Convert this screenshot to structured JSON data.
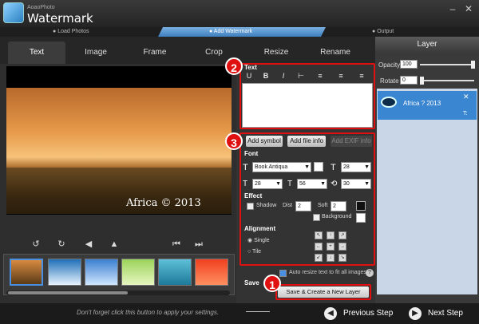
{
  "app": {
    "brand_sub": "AoaoPhoto",
    "title": "Watermark"
  },
  "steps": [
    "Load Photos",
    "Add Watermark",
    "Output"
  ],
  "tabs": [
    "Text",
    "Image",
    "Frame",
    "Crop",
    "Resize",
    "Rename"
  ],
  "preview": {
    "watermark_text": "Africa © 2013"
  },
  "text_section": {
    "label": "Text"
  },
  "buttons": {
    "add_symbol": "Add symbol",
    "add_file_info": "Add file info",
    "add_exif_info": "Add EXIF info"
  },
  "font": {
    "label": "Font",
    "family": "Book Antiqua",
    "size": "28",
    "w": "28",
    "h": "56",
    "angle": "30"
  },
  "effect": {
    "label": "Effect",
    "shadow": "Shadow",
    "dist_label": "Dist",
    "dist": "2",
    "soft_label": "Soft",
    "soft": "2",
    "background": "Background"
  },
  "alignment": {
    "label": "Alignment",
    "single": "Single",
    "tile": "Tile"
  },
  "auto_resize": "Auto resize text to fit all images.",
  "save_label": "Save",
  "save_button": "Save & Create a New Layer",
  "badges": [
    "1",
    "2",
    "3"
  ],
  "layer": {
    "title": "Layer",
    "opacity_label": "Opacity",
    "opacity": "100",
    "rotate_label": "Rotate",
    "rotate": "0",
    "item_name": "Africa ? 2013",
    "item_type": "T:"
  },
  "bottom": {
    "hint": "Don't forget click this button to apply your settings.",
    "previous": "Previous Step",
    "next": "Next Step"
  },
  "colors": {
    "accent": "#3a86d0",
    "highlight": "#e01010"
  }
}
